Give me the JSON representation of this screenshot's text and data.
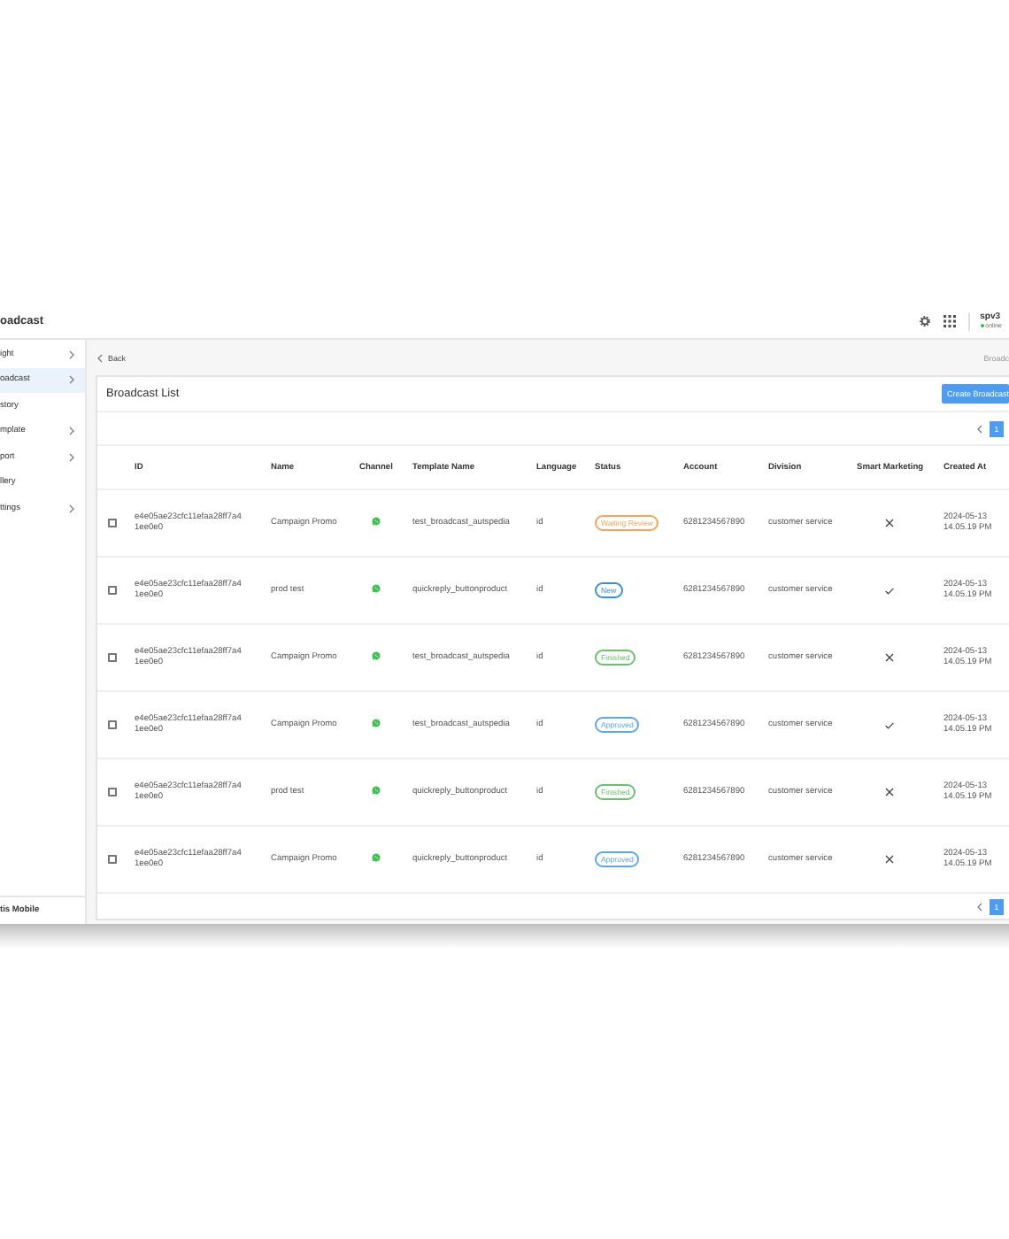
{
  "header": {
    "title": "oadcast",
    "user": "spv3",
    "status": "online"
  },
  "sidebar": {
    "items": [
      {
        "label": "ight",
        "selected": false,
        "expandable": true
      },
      {
        "label": "oadcast",
        "selected": true,
        "expandable": true
      },
      {
        "label": "story",
        "selected": false,
        "expandable": false
      },
      {
        "label": "mplate",
        "selected": false,
        "expandable": true
      },
      {
        "label": "port",
        "selected": false,
        "expandable": true
      },
      {
        "label": "llery",
        "selected": false,
        "expandable": false
      },
      {
        "label": "ttings",
        "selected": false,
        "expandable": true
      }
    ],
    "footer": "tis Mobile"
  },
  "breadcrumb": {
    "back": "Back",
    "current": "Broadc"
  },
  "card": {
    "title": "Broadcast List",
    "create_button": "Create Broadcast",
    "pagination_top": [
      {
        "label": "1",
        "selected": true
      }
    ],
    "pagination_bottom": [
      {
        "label": "1",
        "selected": true
      }
    ]
  },
  "table": {
    "columns": [
      "ID",
      "Name",
      "Channel",
      "Template Name",
      "Language",
      "Status",
      "Account",
      "Division",
      "Smart Marketing",
      "Created At"
    ],
    "rows": [
      {
        "checked": false,
        "id": "e4e05ae23cfc11efaa28ff7a4 1ee0e0",
        "name": "Campaign Promo",
        "template": "test_broadcast_autspedia",
        "language": "id",
        "status": "Waiting Review",
        "color": "#f5a45d",
        "account": "6281234567890",
        "division": "customer service",
        "smart_marketing": false,
        "created_at": "2024-05-13 14.05.19 PM"
      },
      {
        "checked": false,
        "id": "e4e05ae23cfc11efaa28ff7a4 1ee0e0",
        "name": "prod test",
        "template": "quickreply_buttonproduct",
        "language": "id",
        "status": "New",
        "color": "#3a8fd9",
        "account": "6281234567890",
        "division": "customer service",
        "smart_marketing": true,
        "created_at": "2024-05-13 14.05.19 PM"
      },
      {
        "checked": false,
        "id": "e4e05ae23cfc11efaa28ff7a4 1ee0e0",
        "name": "Campaign Promo",
        "template": "test_broadcast_autspedia",
        "language": "id",
        "status": "Finished",
        "color": "#6cbf6c",
        "account": "6281234567890",
        "division": "customer service",
        "smart_marketing": false,
        "created_at": "2024-05-13 14.05.19 PM"
      },
      {
        "checked": false,
        "id": "e4e05ae23cfc11efaa28ff7a4 1ee0e0",
        "name": "Campaign Promo",
        "template": "test_broadcast_autspedia",
        "language": "id",
        "status": "Approved",
        "color": "#5aa6f0",
        "account": "6281234567890",
        "division": "customer service",
        "smart_marketing": true,
        "created_at": "2024-05-13 14.05.19 PM"
      },
      {
        "checked": false,
        "id": "e4e05ae23cfc11efaa28ff7a4 1ee0e0",
        "name": "prod test",
        "template": "quickreply_buttonproduct",
        "language": "id",
        "status": "Finished",
        "color": "#6cbf6c",
        "account": "6281234567890",
        "division": "customer service",
        "smart_marketing": false,
        "created_at": "2024-05-13 14.05.19 PM"
      },
      {
        "checked": false,
        "id": "e4e05ae23cfc11efaa28ff7a4 1ee0e0",
        "name": "Campaign Promo",
        "template": "quickreply_buttonproduct",
        "language": "id",
        "status": "Approved",
        "color": "#5aa6f0",
        "account": "6281234567890",
        "division": "customer service",
        "smart_marketing": false,
        "created_at": "2024-05-13 14.05.19 PM"
      }
    ]
  }
}
